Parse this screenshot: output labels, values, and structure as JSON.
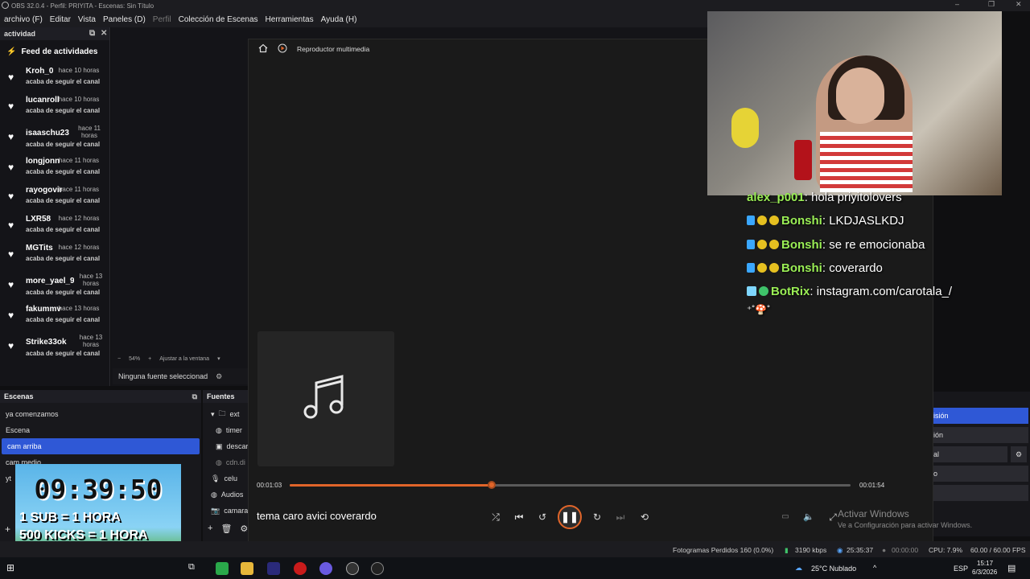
{
  "window": {
    "title": "OBS 32.0.4 - Perfil: PRIYITA - Escenas: Sin Título"
  },
  "menu": {
    "items": [
      "archivo (F)",
      "Editar",
      "Vista",
      "Paneles (D)",
      "Perfil",
      "Colección de Escenas",
      "Herramientas",
      "Ayuda (H)"
    ]
  },
  "activity": {
    "dock_title": "actividad",
    "feed_title": "Feed de actividades",
    "events": [
      {
        "user": "Kroh_0",
        "time": "hace 10 horas",
        "action": "acaba de seguir el canal"
      },
      {
        "user": "lucanroll",
        "time": "hace 10 horas",
        "action": "acaba de seguir el canal"
      },
      {
        "user": "isaaschu23",
        "time": "hace 11 horas",
        "action": "acaba de seguir el canal"
      },
      {
        "user": "longjonn",
        "time": "hace 11 horas",
        "action": "acaba de seguir el canal"
      },
      {
        "user": "rayogovir",
        "time": "hace 11 horas",
        "action": "acaba de seguir el canal"
      },
      {
        "user": "LXR58",
        "time": "hace 12 horas",
        "action": "acaba de seguir el canal"
      },
      {
        "user": "MGTits",
        "time": "hace 12 horas",
        "action": "acaba de seguir el canal"
      },
      {
        "user": "more_yael_90",
        "time": "hace 13 horas",
        "action": "acaba de seguir el canal"
      },
      {
        "user": "fakummv",
        "time": "hace 13 horas",
        "action": "acaba de seguir el canal"
      },
      {
        "user": "Strike33ok",
        "time": "hace 13 horas",
        "action": "acaba de seguir el canal"
      }
    ]
  },
  "preview": {
    "zoom": "54%",
    "fit_label": "Ajustar a la ventana",
    "no_source": "Ninguna fuente seleccionad"
  },
  "player": {
    "title": "Reproductor multimedia",
    "song": "tema caro avici coverardo",
    "current_time": "00:01:03",
    "total_time": "00:01:54",
    "progress": 0.36
  },
  "chat": [
    {
      "user": "alex_p001",
      "message": "hola priyitolovers"
    },
    {
      "user": "Bonshi",
      "message": "LKDJASLKDJ"
    },
    {
      "user": "Bonshi",
      "message": "se re emocionaba"
    },
    {
      "user": "Bonshi",
      "message": "coverardo"
    },
    {
      "user": "BotRix",
      "message": "instagram.com/carotala_/"
    }
  ],
  "scenes": {
    "title": "Escenas",
    "items": [
      "ya comenzamos",
      "Escena",
      "cam arriba",
      "cam medio",
      "yt"
    ],
    "selected": "cam arriba"
  },
  "sources": {
    "title": "Fuentes",
    "items": [
      "ext",
      "timer",
      "descar",
      "cdn.di",
      "celu",
      "Audios",
      "camara"
    ]
  },
  "overlay": {
    "clock": "09:39:50",
    "line1": "1 SUB = 1 HORA",
    "line2": "500 KICKS = 1 HORA"
  },
  "right_dock": {
    "items": [
      "isión",
      "ión",
      "al",
      "o"
    ]
  },
  "status": {
    "frames_dropped": "Fotogramas Perdidos 160 (0.0%)",
    "bitrate": "3190 kbps",
    "live_time": "25:35:37",
    "rec_time": "00:00:00",
    "cpu": "CPU: 7.9%",
    "fps": "60.00 / 60.00 FPS"
  },
  "watermark": {
    "line1": "Activar Windows",
    "line2": "Ve a Configuración para activar Windows."
  },
  "taskbar": {
    "weather": "25°C  Nublado",
    "lang": "ESP",
    "time": "15:17",
    "date": "6/3/2026"
  },
  "colors": {
    "accent": "#2f58d6",
    "progress": "#e0652a",
    "chat_user": "#9aee55"
  }
}
